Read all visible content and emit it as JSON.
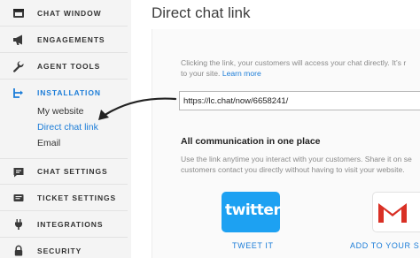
{
  "sidebar": {
    "items": [
      {
        "label": "CHAT WINDOW",
        "icon": "chat-window-icon"
      },
      {
        "label": "ENGAGEMENTS",
        "icon": "megaphone-icon"
      },
      {
        "label": "AGENT TOOLS",
        "icon": "wrench-icon"
      },
      {
        "label": "INSTALLATION",
        "icon": "installation-icon",
        "active": true
      },
      {
        "label": "CHAT SETTINGS",
        "icon": "chat-settings-icon"
      },
      {
        "label": "TICKET SETTINGS",
        "icon": "ticket-icon"
      },
      {
        "label": "INTEGRATIONS",
        "icon": "plug-icon"
      },
      {
        "label": "SECURITY",
        "icon": "lock-icon"
      }
    ],
    "sub_items": [
      {
        "label": "My website"
      },
      {
        "label": "Direct chat link",
        "active": true
      },
      {
        "label": "Email"
      }
    ]
  },
  "main": {
    "title": "Direct chat link",
    "intro_line1": "Clicking the link, your customers will access your chat directly. It’s r",
    "intro_line2": "to your site.",
    "learn_more": "Learn more",
    "chat_link_value": "https://lc.chat/now/6658241/",
    "section_heading": "All communication in one place",
    "section_line1": "Use the link anytime you interact with your customers. Share it on se",
    "section_line2": "customers contact you directly without having to visit your website.",
    "share": {
      "twitter_logo_text": "twitter",
      "tweet_label": "TWEET IT",
      "add_label": "ADD TO YOUR SIG"
    }
  },
  "colors": {
    "accent": "#1c7dd8",
    "sidebar_bg": "#f4f4f4",
    "twitter": "#1da1f2",
    "gmail_red": "#d93025"
  }
}
